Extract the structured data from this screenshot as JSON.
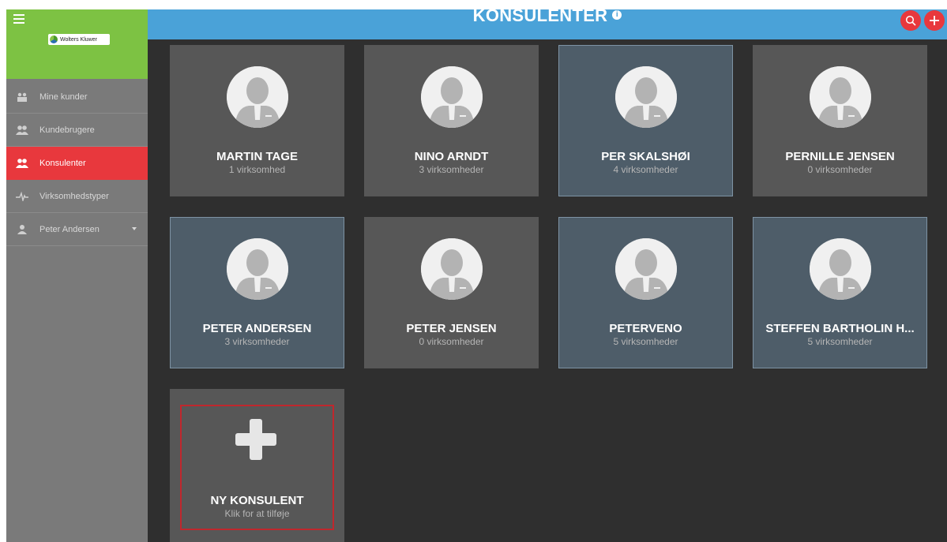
{
  "brand": {
    "logo_text": "Wolters Kluwer"
  },
  "header": {
    "title": "KONSULENTER",
    "info_icon": "info-icon",
    "search_icon": "search-icon",
    "add_icon": "plus-icon",
    "accent": "#4aa2d8",
    "button_color": "#e8383d"
  },
  "sidebar": {
    "items": [
      {
        "label": "Mine kunder",
        "icon": "customers-icon",
        "active": false
      },
      {
        "label": "Kundebrugere",
        "icon": "users-icon",
        "active": false
      },
      {
        "label": "Konsulenter",
        "icon": "consultants-icon",
        "active": true
      },
      {
        "label": "Virksomhedstyper",
        "icon": "pulse-icon",
        "active": false
      },
      {
        "label": "Peter Andersen",
        "icon": "user-icon",
        "active": false,
        "has_dropdown": true
      }
    ]
  },
  "consultants": [
    {
      "name": "MARTIN TAGE",
      "count": "1 virksomhed",
      "highlight": false
    },
    {
      "name": "NINO ARNDT",
      "count": "3 virksomheder",
      "highlight": false
    },
    {
      "name": "PER SKALSHØI",
      "count": "4 virksomheder",
      "highlight": true
    },
    {
      "name": "PERNILLE JENSEN",
      "count": "0 virksomheder",
      "highlight": false
    },
    {
      "name": "PETER ANDERSEN",
      "count": "3 virksomheder",
      "highlight": true
    },
    {
      "name": "PETER JENSEN",
      "count": "0 virksomheder",
      "highlight": false
    },
    {
      "name": "PETERVENO",
      "count": "5 virksomheder",
      "highlight": true
    },
    {
      "name": "STEFFEN BARTHOLIN H...",
      "count": "5 virksomheder",
      "highlight": true
    }
  ],
  "new_consultant": {
    "title": "NY KONSULENT",
    "subtitle": "Klik for at tilføje"
  }
}
